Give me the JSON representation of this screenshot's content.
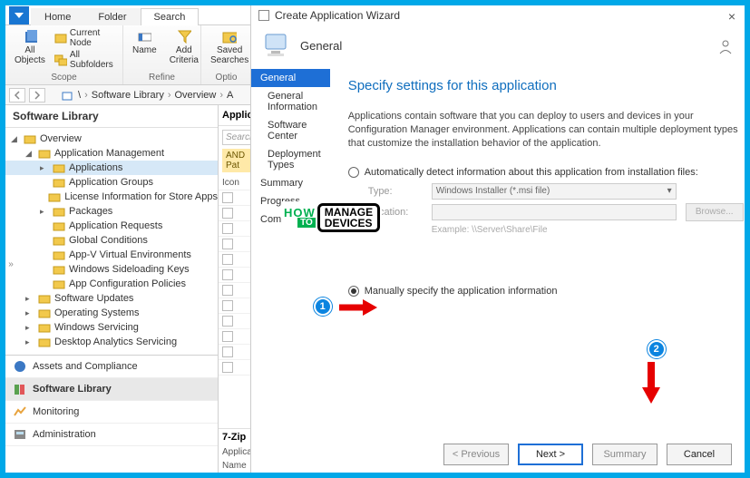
{
  "tabs": {
    "home": "Home",
    "folder": "Folder",
    "search": "Search"
  },
  "ribbon": {
    "scope": {
      "label": "Scope",
      "all_objects": "All\nObjects",
      "current_node": "Current Node",
      "all_subfolders": "All Subfolders"
    },
    "refine": {
      "label": "Refine",
      "name": "Name",
      "add_criteria": "Add\nCriteria"
    },
    "options": {
      "label": "Optio",
      "saved_searches": "Saved\nSearches"
    }
  },
  "breadcrumb": {
    "root": "\\",
    "p1": "Software Library",
    "p2": "Overview",
    "p3": "A"
  },
  "tree": {
    "title": "Software Library",
    "items": [
      {
        "label": "Overview",
        "exp": "open",
        "ind": 0,
        "sel": false
      },
      {
        "label": "Application Management",
        "exp": "open",
        "ind": 1,
        "sel": false
      },
      {
        "label": "Applications",
        "exp": "closed",
        "ind": 2,
        "sel": true
      },
      {
        "label": "Application Groups",
        "exp": "none",
        "ind": 2,
        "sel": false
      },
      {
        "label": "License Information for Store Apps",
        "exp": "none",
        "ind": 2,
        "sel": false
      },
      {
        "label": "Packages",
        "exp": "closed",
        "ind": 2,
        "sel": false
      },
      {
        "label": "Application Requests",
        "exp": "none",
        "ind": 2,
        "sel": false
      },
      {
        "label": "Global Conditions",
        "exp": "none",
        "ind": 2,
        "sel": false
      },
      {
        "label": "App-V Virtual Environments",
        "exp": "none",
        "ind": 2,
        "sel": false
      },
      {
        "label": "Windows Sideloading Keys",
        "exp": "none",
        "ind": 2,
        "sel": false
      },
      {
        "label": "App Configuration Policies",
        "exp": "none",
        "ind": 2,
        "sel": false
      },
      {
        "label": "Software Updates",
        "exp": "closed",
        "ind": 1,
        "sel": false
      },
      {
        "label": "Operating Systems",
        "exp": "closed",
        "ind": 1,
        "sel": false
      },
      {
        "label": "Windows Servicing",
        "exp": "closed",
        "ind": 1,
        "sel": false
      },
      {
        "label": "Desktop Analytics Servicing",
        "exp": "closed",
        "ind": 1,
        "sel": false
      }
    ]
  },
  "navpanes": {
    "assets": "Assets and Compliance",
    "software": "Software Library",
    "monitoring": "Monitoring",
    "admin": "Administration"
  },
  "mid": {
    "head": "Applicatio",
    "search_placeholder": "Search",
    "and_bar": "AND Pat",
    "col_icon": "Icon",
    "foot_title": "7-Zip",
    "foot_row1": "Applicatio",
    "foot_row2": "Name"
  },
  "wizard": {
    "window_title": "Create Application Wizard",
    "header_label": "General",
    "steps": {
      "general": "General",
      "general_info": "General Information",
      "software_center": "Software Center",
      "deployment_types": "Deployment Types",
      "summary": "Summary",
      "progress": "Progress",
      "completion": "Completion"
    },
    "heading": "Specify settings for this application",
    "description": "Applications contain software that you can deploy to users and devices in your Configuration Manager environment. Applications can contain multiple deployment types that customize the installation behavior of the application.",
    "opt_auto": "Automatically detect information about this application from installation files:",
    "type_label": "Type:",
    "type_value": "Windows Installer (*.msi file)",
    "location_label": "Location:",
    "browse": "Browse...",
    "example": "Example: \\\\Server\\Share\\File",
    "opt_manual": "Manually specify the application information",
    "buttons": {
      "previous": "< Previous",
      "next": "Next >",
      "summary": "Summary",
      "cancel": "Cancel"
    }
  },
  "badges": {
    "one": "1",
    "two": "2"
  },
  "logo": {
    "how": "HOW",
    "to": "TO",
    "manage": "MANAGE",
    "devices": "DEVICES"
  }
}
